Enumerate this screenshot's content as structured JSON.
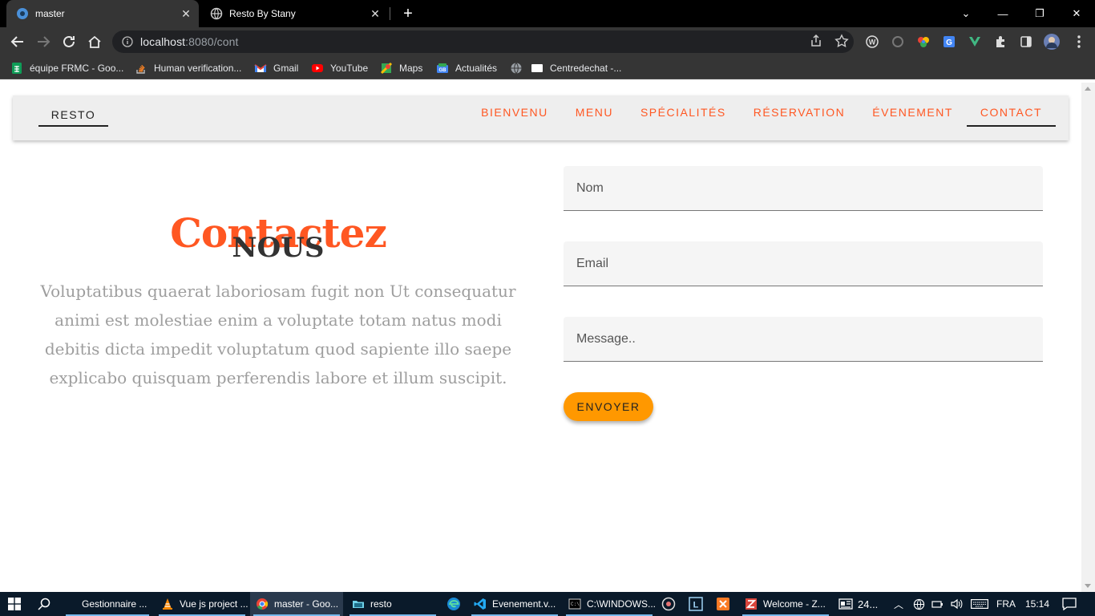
{
  "browser": {
    "tabs": [
      {
        "title": "master",
        "active": true
      },
      {
        "title": "Resto By Stany",
        "active": false
      }
    ],
    "url_host": "localhost",
    "url_path": ":8080/cont",
    "bookmarks": [
      {
        "label": "équipe FRMC - Goo...",
        "icon": "google-sheets-icon",
        "color": "#0f9d58"
      },
      {
        "label": "Human verification...",
        "icon": "stackoverflow-icon",
        "color": "#f48024"
      },
      {
        "label": "Gmail",
        "icon": "gmail-icon",
        "color": "#ea4335"
      },
      {
        "label": "YouTube",
        "icon": "youtube-icon",
        "color": "#ff0000"
      },
      {
        "label": "Maps",
        "icon": "maps-icon",
        "color": "#34a853"
      },
      {
        "label": "Actualités",
        "icon": "news-icon",
        "color": "#4285f4"
      },
      {
        "label": "",
        "icon": "globe-icon",
        "color": "#9aa0a6"
      },
      {
        "label": "Centredechat -...",
        "icon": "page-icon",
        "color": "#ffffff"
      }
    ]
  },
  "site": {
    "brand": "RESTO",
    "nav": [
      {
        "label": "BIENVENU",
        "active": false
      },
      {
        "label": "MENU",
        "active": false
      },
      {
        "label": "SPÉCIALITÉS",
        "active": false
      },
      {
        "label": "RÉSERVATION",
        "active": false
      },
      {
        "label": "ÉVENEMENT",
        "active": false
      },
      {
        "label": "CONTACT",
        "active": true
      }
    ],
    "hero": {
      "title": "Contactez",
      "subtitle": "NOUS",
      "text": "Voluptatibus quaerat laboriosam fugit non Ut consequatur animi est molestiae enim a voluptate totam natus modi debitis dicta impedit voluptatum quod sapiente illo saepe explicabo quisquam perferendis labore et illum suscipit."
    },
    "form": {
      "name_placeholder": "Nom",
      "email_placeholder": "Email",
      "message_placeholder": "Message..",
      "submit_label": "ENVOYER"
    },
    "colors": {
      "accent": "#ff5722",
      "button": "#ff9800",
      "muted": "#9e9e9e"
    }
  },
  "taskbar": {
    "items": [
      {
        "label": "Gestionnaire ...",
        "icon": "task-manager-icon"
      },
      {
        "label": "Vue js project ...",
        "icon": "vlc-icon"
      },
      {
        "label": "master - Goo...",
        "icon": "chrome-icon"
      },
      {
        "label": "resto",
        "icon": "folder-icon"
      },
      {
        "label": "Evenement.v...",
        "icon": "vscode-icon"
      },
      {
        "label": "C:\\WINDOWS...",
        "icon": "cmd-icon"
      },
      {
        "label": "Welcome - Z...",
        "icon": "zend-icon"
      }
    ],
    "weather": "24...",
    "language": "FRA",
    "time": "15:14"
  }
}
